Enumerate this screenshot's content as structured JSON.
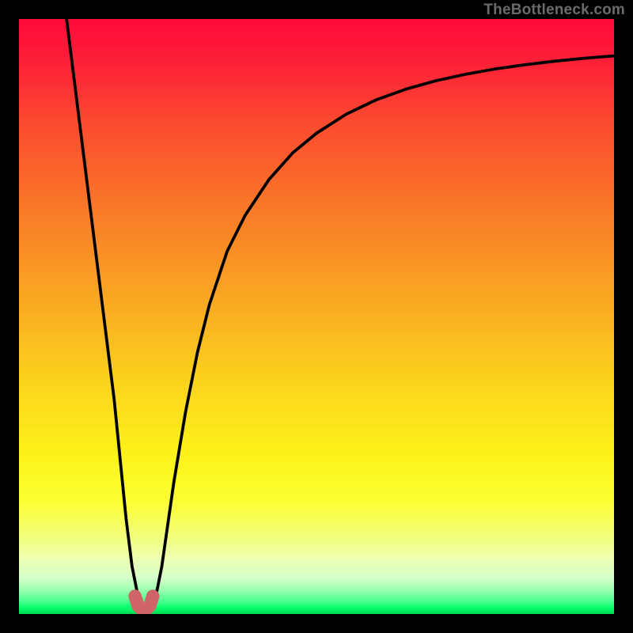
{
  "watermark": "TheBottleneck.com",
  "colors": {
    "frame": "#000000",
    "curve": "#000000",
    "marker": "#cf6569",
    "gradient_top": "#ff0a3a",
    "gradient_bottom": "#00d850"
  },
  "chart_data": {
    "type": "line",
    "title": "",
    "xlabel": "",
    "ylabel": "",
    "xlim": [
      0,
      100
    ],
    "ylim": [
      0,
      100
    ],
    "series": [
      {
        "name": "bottleneck-curve",
        "x": [
          8,
          10,
          12,
          14,
          16,
          17,
          18,
          19,
          20,
          21,
          22,
          23,
          24,
          25,
          26,
          28,
          30,
          32,
          35,
          38,
          42,
          46,
          50,
          55,
          60,
          65,
          70,
          75,
          80,
          85,
          90,
          95,
          100
        ],
        "y": [
          100,
          84,
          68,
          52,
          36,
          26,
          16,
          8,
          3,
          1,
          1,
          3,
          8,
          15,
          22,
          34,
          44,
          52,
          61,
          67,
          73,
          77.5,
          80.8,
          84,
          86.4,
          88.2,
          89.6,
          90.7,
          91.6,
          92.3,
          92.9,
          93.4,
          93.8
        ]
      }
    ],
    "optimal_marker": {
      "name": "optimal-range",
      "x": [
        19.5,
        20,
        20.5,
        21,
        21.5,
        22,
        22.5
      ],
      "y": [
        3.0,
        1.4,
        0.9,
        0.8,
        0.9,
        1.4,
        3.0
      ]
    },
    "background": "vertical-gradient red→orange→yellow→green",
    "grid": false
  }
}
